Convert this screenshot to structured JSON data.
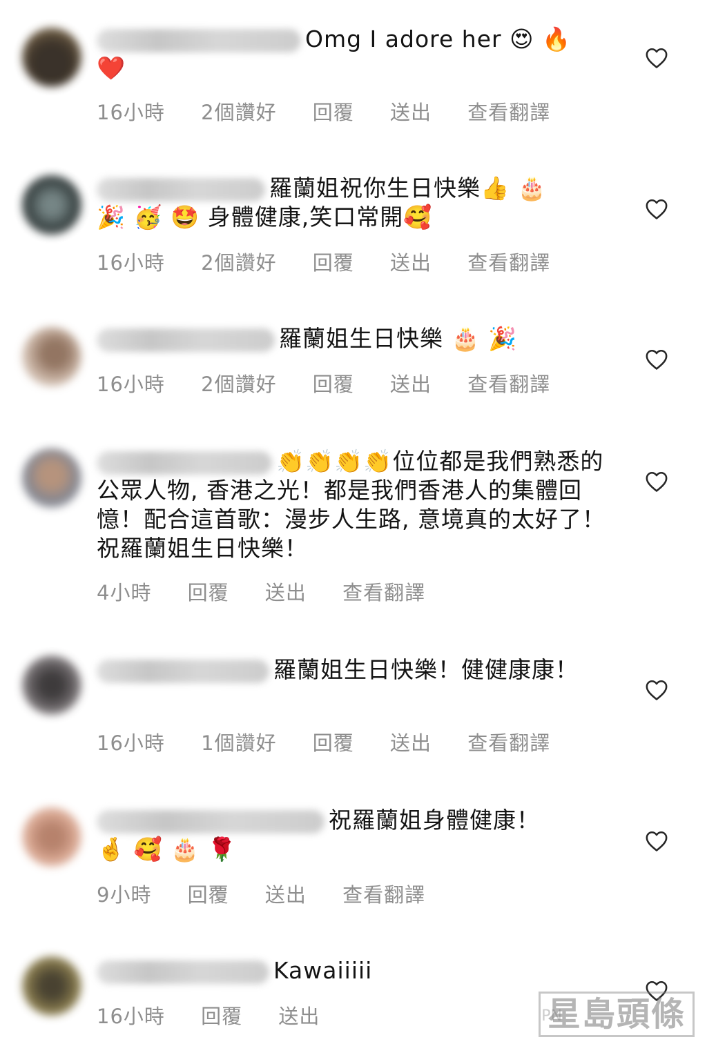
{
  "comments": [
    {
      "text": "Omg I adore her",
      "emoji": "😍 🔥 ❤️",
      "time": "16小時",
      "likes": "2個讚好",
      "reply": "回覆",
      "send": "送出",
      "translate": "查看翻譯"
    },
    {
      "text": "羅蘭姐祝你生日快樂",
      "emoji1": "👍 🎂",
      "emoji2": "🎉 🥳 🤩",
      "text2": "身體健康,笑口常開",
      "emoji3": "🥰",
      "time": "16小時",
      "likes": "2個讚好",
      "reply": "回覆",
      "send": "送出",
      "translate": "查看翻譯"
    },
    {
      "text": "羅蘭姐生日快樂",
      "emoji": "🎂 🎉",
      "time": "16小時",
      "likes": "2個讚好",
      "reply": "回覆",
      "send": "送出",
      "translate": "查看翻譯"
    },
    {
      "emoji": "👏👏👏👏",
      "text": "位位都是我們熟悉的公眾人物, 香港之光！都是我們香港人的集體回憶！配合這首歌：漫步人生路, 意境真的太好了！祝羅蘭姐生日快樂！",
      "time": "4小時",
      "reply": "回覆",
      "send": "送出",
      "translate": "查看翻譯"
    },
    {
      "text": "羅蘭姐生日快樂！健健康康！",
      "time": "16小時",
      "likes": "1個讚好",
      "reply": "回覆",
      "send": "送出",
      "translate": "查看翻譯"
    },
    {
      "text": "祝羅蘭姐身體健康！",
      "emoji": "🤞 🥰 🎂 🌹",
      "time": "9小時",
      "reply": "回覆",
      "send": "送出",
      "translate": "查看翻譯"
    },
    {
      "text": "Kawaiiiii",
      "time": "16小時",
      "reply": "回覆",
      "send": "送出"
    }
  ],
  "watermark": "星島頭條",
  "watermark_small": "PN",
  "colors": {
    "meta": "#8e8e8e",
    "text": "#141414",
    "heart_stroke": "#262626"
  },
  "icons": {
    "like": "heart-outline-icon"
  }
}
